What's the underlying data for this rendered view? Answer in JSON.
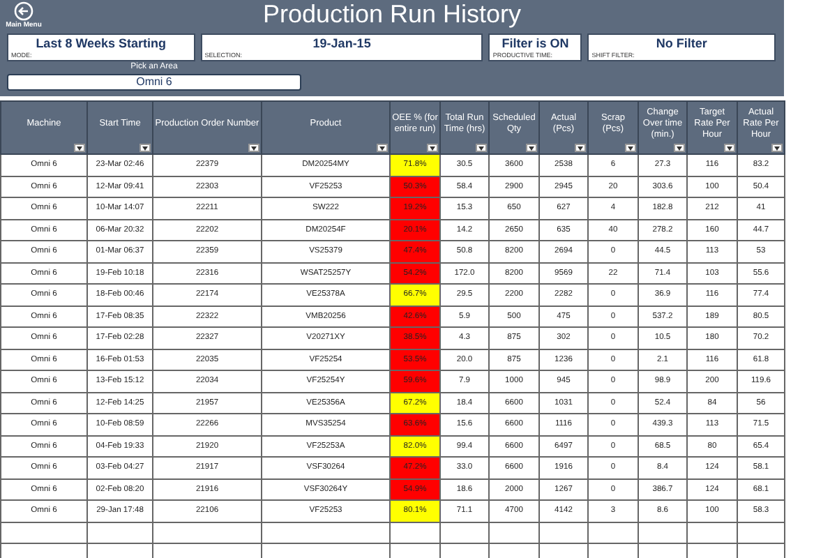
{
  "header": {
    "back_label": "Main Menu",
    "title": "Production Run History"
  },
  "filters": [
    {
      "value": "Last 8 Weeks Starting",
      "label": "MODE:"
    },
    {
      "value": "19-Jan-15",
      "label": "SELECTION:"
    },
    {
      "value": "Filter is ON",
      "label": "PRODUCTIVE TIME:"
    },
    {
      "value": "No Filter",
      "label": "SHIFT FILTER:"
    }
  ],
  "area_picker": {
    "label": "Pick an Area",
    "value": "Omni 6"
  },
  "table": {
    "columns": [
      "Machine",
      "Start Time",
      "Production Order Number",
      "Product",
      "OEE % (for entire run)",
      "Total Run Time (hrs)",
      "Scheduled Qty",
      "Actual (Pcs)",
      "Scrap (Pcs)",
      "Change Over time (min.)",
      "Target Rate Per Hour",
      "Actual Rate Per Hour"
    ],
    "rows": [
      {
        "cells": [
          "Omni 6",
          "23-Mar 02:46",
          "22379",
          "DM20254MY",
          "71.8%",
          "30.5",
          "3600",
          "2538",
          "6",
          "27.3",
          "116",
          "83.2"
        ],
        "color": "#ffff00"
      },
      {
        "cells": [
          "Omni 6",
          "12-Mar 09:41",
          "22303",
          "VF25253",
          "50.3%",
          "58.4",
          "2900",
          "2945",
          "20",
          "303.6",
          "100",
          "50.4"
        ],
        "color": "#ff0000"
      },
      {
        "cells": [
          "Omni 6",
          "10-Mar 14:07",
          "22211",
          "SW222",
          "19.2%",
          "15.3",
          "650",
          "627",
          "4",
          "182.8",
          "212",
          "41"
        ],
        "color": "#ff0000"
      },
      {
        "cells": [
          "Omni 6",
          "06-Mar 20:32",
          "22202",
          "DM20254F",
          "20.1%",
          "14.2",
          "2650",
          "635",
          "40",
          "278.2",
          "160",
          "44.7"
        ],
        "color": "#ff0000"
      },
      {
        "cells": [
          "Omni 6",
          "01-Mar 06:37",
          "22359",
          "VS25379",
          "47.4%",
          "50.8",
          "8200",
          "2694",
          "0",
          "44.5",
          "113",
          "53"
        ],
        "color": "#ff0000"
      },
      {
        "cells": [
          "Omni 6",
          "19-Feb 10:18",
          "22316",
          "WSAT25257Y",
          "54.2%",
          "172.0",
          "8200",
          "9569",
          "22",
          "71.4",
          "103",
          "55.6"
        ],
        "color": "#ff0000"
      },
      {
        "cells": [
          "Omni 6",
          "18-Feb 00:46",
          "22174",
          "VE25378A",
          "66.7%",
          "29.5",
          "2200",
          "2282",
          "0",
          "36.9",
          "116",
          "77.4"
        ],
        "color": "#ffff00"
      },
      {
        "cells": [
          "Omni 6",
          "17-Feb 08:35",
          "22322",
          "VMB20256",
          "42.6%",
          "5.9",
          "500",
          "475",
          "0",
          "537.2",
          "189",
          "80.5"
        ],
        "color": "#ff0000"
      },
      {
        "cells": [
          "Omni 6",
          "17-Feb 02:28",
          "22327",
          "V20271XY",
          "38.5%",
          "4.3",
          "875",
          "302",
          "0",
          "10.5",
          "180",
          "70.2"
        ],
        "color": "#ff0000"
      },
      {
        "cells": [
          "Omni 6",
          "16-Feb 01:53",
          "22035",
          "VF25254",
          "53.5%",
          "20.0",
          "875",
          "1236",
          "0",
          "2.1",
          "116",
          "61.8"
        ],
        "color": "#ff0000"
      },
      {
        "cells": [
          "Omni 6",
          "13-Feb 15:12",
          "22034",
          "VF25254Y",
          "59.6%",
          "7.9",
          "1000",
          "945",
          "0",
          "98.9",
          "200",
          "119.6"
        ],
        "color": "#ff0000"
      },
      {
        "cells": [
          "Omni 6",
          "12-Feb 14:25",
          "21957",
          "VE25356A",
          "67.2%",
          "18.4",
          "6600",
          "1031",
          "0",
          "52.4",
          "84",
          "56"
        ],
        "color": "#ffff00"
      },
      {
        "cells": [
          "Omni 6",
          "10-Feb 08:59",
          "22266",
          "MVS35254",
          "63.6%",
          "15.6",
          "6600",
          "1116",
          "0",
          "439.3",
          "113",
          "71.5"
        ],
        "color": "#ff0000"
      },
      {
        "cells": [
          "Omni 6",
          "04-Feb 19:33",
          "21920",
          "VF25253A",
          "82.0%",
          "99.4",
          "6600",
          "6497",
          "0",
          "68.5",
          "80",
          "65.4"
        ],
        "color": "#ffff00"
      },
      {
        "cells": [
          "Omni 6",
          "03-Feb 04:27",
          "21917",
          "VSF30264",
          "47.2%",
          "33.0",
          "6600",
          "1916",
          "0",
          "8.4",
          "124",
          "58.1"
        ],
        "color": "#ff0000"
      },
      {
        "cells": [
          "Omni 6",
          "02-Feb 08:20",
          "21916",
          "VSF30264Y",
          "54.9%",
          "18.6",
          "2000",
          "1267",
          "0",
          "386.7",
          "124",
          "68.1"
        ],
        "color": "#ff0000"
      },
      {
        "cells": [
          "Omni 6",
          "29-Jan 17:48",
          "22106",
          "VF25253",
          "80.1%",
          "71.1",
          "4700",
          "4142",
          "3",
          "8.6",
          "100",
          "58.3"
        ],
        "color": "#ffff00"
      }
    ]
  }
}
